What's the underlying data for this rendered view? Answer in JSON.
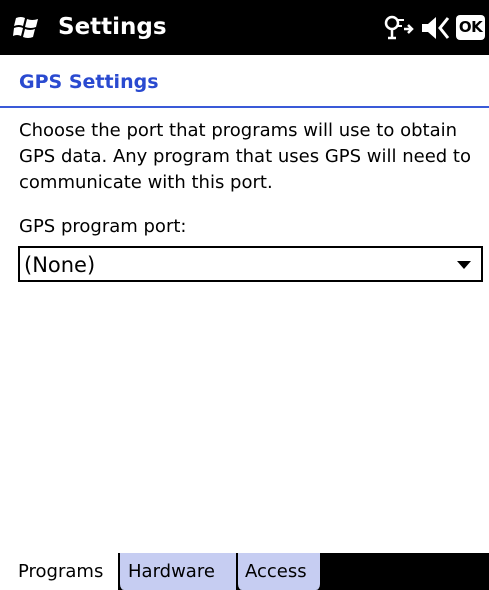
{
  "titlebar": {
    "title": "Settings",
    "start_icon": "windows-logo-icon",
    "status_icons": [
      "connectivity-icon",
      "speaker-icon"
    ],
    "ok_label": "OK"
  },
  "page": {
    "header": "GPS Settings",
    "description": "Choose the port that programs will use to obtain GPS data. Any program that uses GPS will need to communicate with this port.",
    "field_label": "GPS program port:",
    "port_select": {
      "value": "(None)"
    }
  },
  "tabs": [
    {
      "label": "Programs",
      "selected": true
    },
    {
      "label": "Hardware",
      "selected": false
    },
    {
      "label": "Access",
      "selected": false
    }
  ],
  "colors": {
    "header_text": "#2a4ad0",
    "header_rule": "#3a5ad8",
    "inactive_tab": "#c6cdf2",
    "titlebar": "#000000"
  }
}
